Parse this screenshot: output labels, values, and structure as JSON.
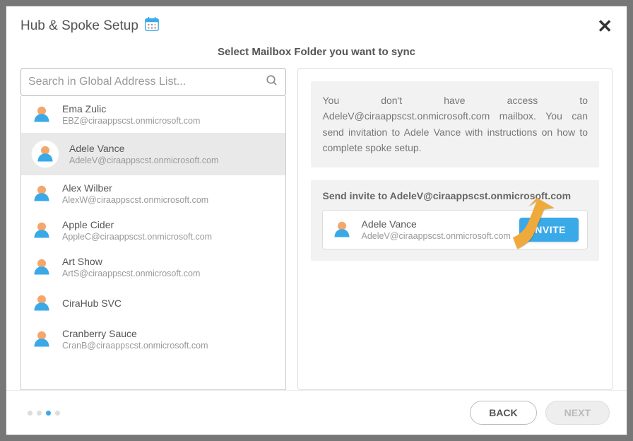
{
  "header": {
    "title": "Hub & Spoke Setup"
  },
  "instruction": "Select Mailbox Folder you want to sync",
  "search": {
    "placeholder": "Search in Global Address List..."
  },
  "people": [
    {
      "name": "Ema Zulic",
      "email": "EBZ@ciraappscst.onmicrosoft.com",
      "selected": false
    },
    {
      "name": "Adele Vance",
      "email": "AdeleV@ciraappscst.onmicrosoft.com",
      "selected": true
    },
    {
      "name": "Alex Wilber",
      "email": "AlexW@ciraappscst.onmicrosoft.com",
      "selected": false
    },
    {
      "name": "Apple Cider",
      "email": "AppleC@ciraappscst.onmicrosoft.com",
      "selected": false
    },
    {
      "name": "Art Show",
      "email": "ArtS@ciraappscst.onmicrosoft.com",
      "selected": false
    },
    {
      "name": "CiraHub SVC",
      "email": "",
      "selected": false
    },
    {
      "name": "Cranberry Sauce",
      "email": "CranB@ciraappscst.onmicrosoft.com",
      "selected": false
    }
  ],
  "right": {
    "message": "You don't have access to AdeleV@ciraappscst.onmicrosoft.com mailbox. You can send invitation to Adele Vance with instructions on how to complete spoke setup.",
    "invite_heading": "Send invite to AdeleV@ciraappscst.onmicrosoft.com",
    "invite_person": {
      "name": "Adele Vance",
      "email": "AdeleV@ciraappscst.onmicrosoft.com"
    },
    "invite_button": "INVITE"
  },
  "footer": {
    "back": "BACK",
    "next": "NEXT",
    "active_step": 2,
    "total_steps": 4
  }
}
